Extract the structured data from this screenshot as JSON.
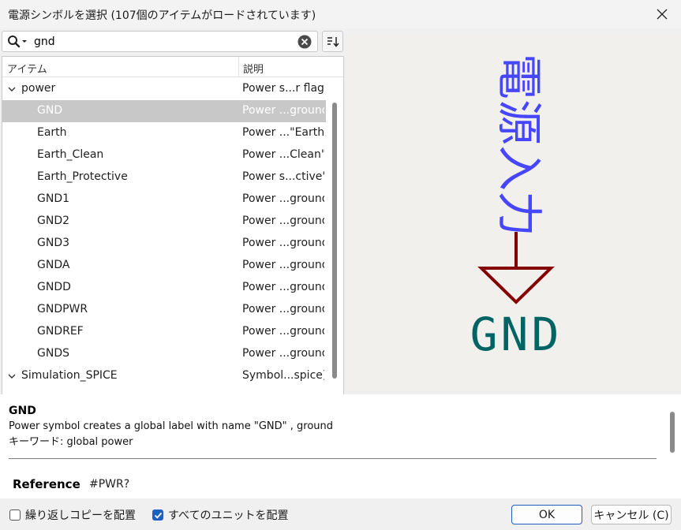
{
  "window": {
    "title": "電源シンボルを選択 (107個のアイテムがロードされています)"
  },
  "search": {
    "value": "gnd",
    "placeholder": ""
  },
  "tree": {
    "columns": [
      "アイテム",
      "説明"
    ],
    "rows": [
      {
        "kind": "group",
        "expanded": true,
        "name": "power",
        "desc": "Power s...r flags"
      },
      {
        "kind": "child",
        "name": "GND",
        "desc": "Power ...ground",
        "selected": true
      },
      {
        "kind": "child",
        "name": "Earth",
        "desc": "Power ...\"Earth\""
      },
      {
        "kind": "child",
        "name": "Earth_Clean",
        "desc": "Power ...Clean\""
      },
      {
        "kind": "child",
        "name": "Earth_Protective",
        "desc": "Power s...ctive\""
      },
      {
        "kind": "child",
        "name": "GND1",
        "desc": "Power ...ground"
      },
      {
        "kind": "child",
        "name": "GND2",
        "desc": "Power ...ground"
      },
      {
        "kind": "child",
        "name": "GND3",
        "desc": "Power ...ground"
      },
      {
        "kind": "child",
        "name": "GNDA",
        "desc": "Power ...ground"
      },
      {
        "kind": "child",
        "name": "GNDD",
        "desc": "Power ...ground"
      },
      {
        "kind": "child",
        "name": "GNDPWR",
        "desc": "Power ...ground"
      },
      {
        "kind": "child",
        "name": "GNDREF",
        "desc": "Power ...ground"
      },
      {
        "kind": "child",
        "name": "GNDS",
        "desc": "Power ...ground"
      },
      {
        "kind": "group",
        "expanded": true,
        "name": "Simulation_SPICE",
        "desc": "Symbol...spice)."
      }
    ]
  },
  "preview": {
    "vertical_text": "電源入力",
    "symbol_label": "GND",
    "colors": {
      "vertical_text": "#4646ff",
      "symbol": "#840000",
      "label": "#006464",
      "background": "#f2f0ec"
    }
  },
  "details": {
    "symbol_name": "GND",
    "description": "Power symbol creates a global label with name \"GND\" , ground",
    "keywords_line": "キーワード: global power",
    "reference_label": "Reference",
    "reference_value": "#PWR?"
  },
  "footer": {
    "repeat_copy": {
      "label": "繰り返しコピーを配置",
      "checked": false
    },
    "all_units": {
      "label": "すべてのユニットを配置",
      "checked": true
    },
    "ok_label": "OK",
    "cancel_label": "キャンセル (C)"
  },
  "accent_color": "#1f5fbf"
}
